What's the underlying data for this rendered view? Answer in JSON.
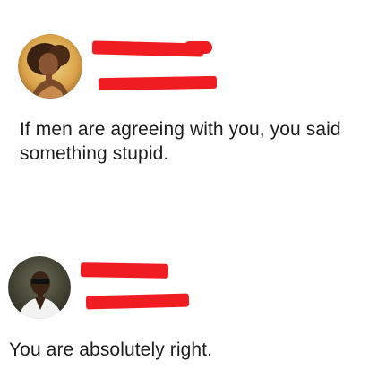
{
  "colors": {
    "background": "#ffffff",
    "text": "#1c1c1c",
    "redaction": "#ef1c22"
  },
  "posts": [
    {
      "author_name": "",
      "author_handle": "",
      "avatar_icon": "user-avatar-woman",
      "text_line_1": "If men are agreeing with you, you said",
      "text_line_2": "something stupid."
    },
    {
      "author_name": "",
      "author_handle": "",
      "avatar_icon": "user-avatar-man",
      "text_line_1": "You are absolutely right."
    }
  ]
}
